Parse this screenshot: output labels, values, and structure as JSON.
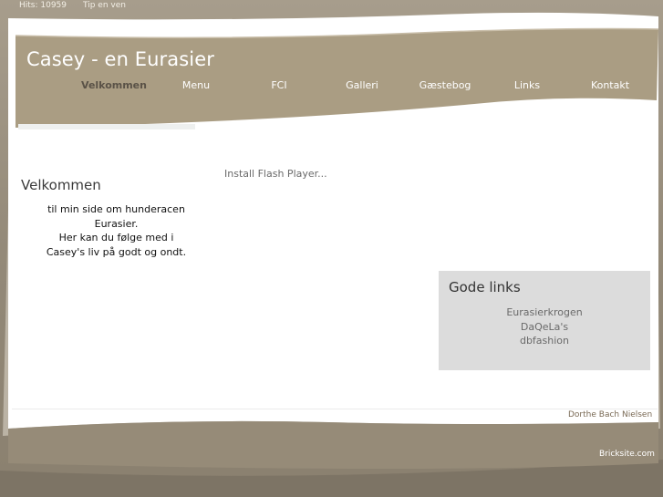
{
  "topbar": {
    "hits": "Hits: 10959",
    "tip": "Tip en ven"
  },
  "header": {
    "title": "Casey - en Eurasier",
    "nav": [
      {
        "label": "Velkommen",
        "active": true
      },
      {
        "label": "Menu"
      },
      {
        "label": "FCI"
      },
      {
        "label": "Galleri"
      },
      {
        "label": "Gæstebog"
      },
      {
        "label": "Links"
      },
      {
        "label": "Kontakt"
      }
    ]
  },
  "flash": {
    "text": "Install Flash Player..."
  },
  "welcome": {
    "title": "Velkommen",
    "lines": [
      "til min side om hunderacen",
      "Eurasier.",
      "Her kan du følge med i",
      "Casey's liv på godt og ondt."
    ]
  },
  "links_box": {
    "title": "Gode links",
    "links": [
      "Eurasierkrogen",
      "DaQeLa's",
      "dbfashion"
    ]
  },
  "footer": {
    "author": "Dorthe Bach Nielsen",
    "brand": "Bricksite.com"
  },
  "colors": {
    "frame": "#948a79",
    "banner": "#aa9d83",
    "box": "#dcdcdc",
    "nav_active": "#5a5247"
  }
}
